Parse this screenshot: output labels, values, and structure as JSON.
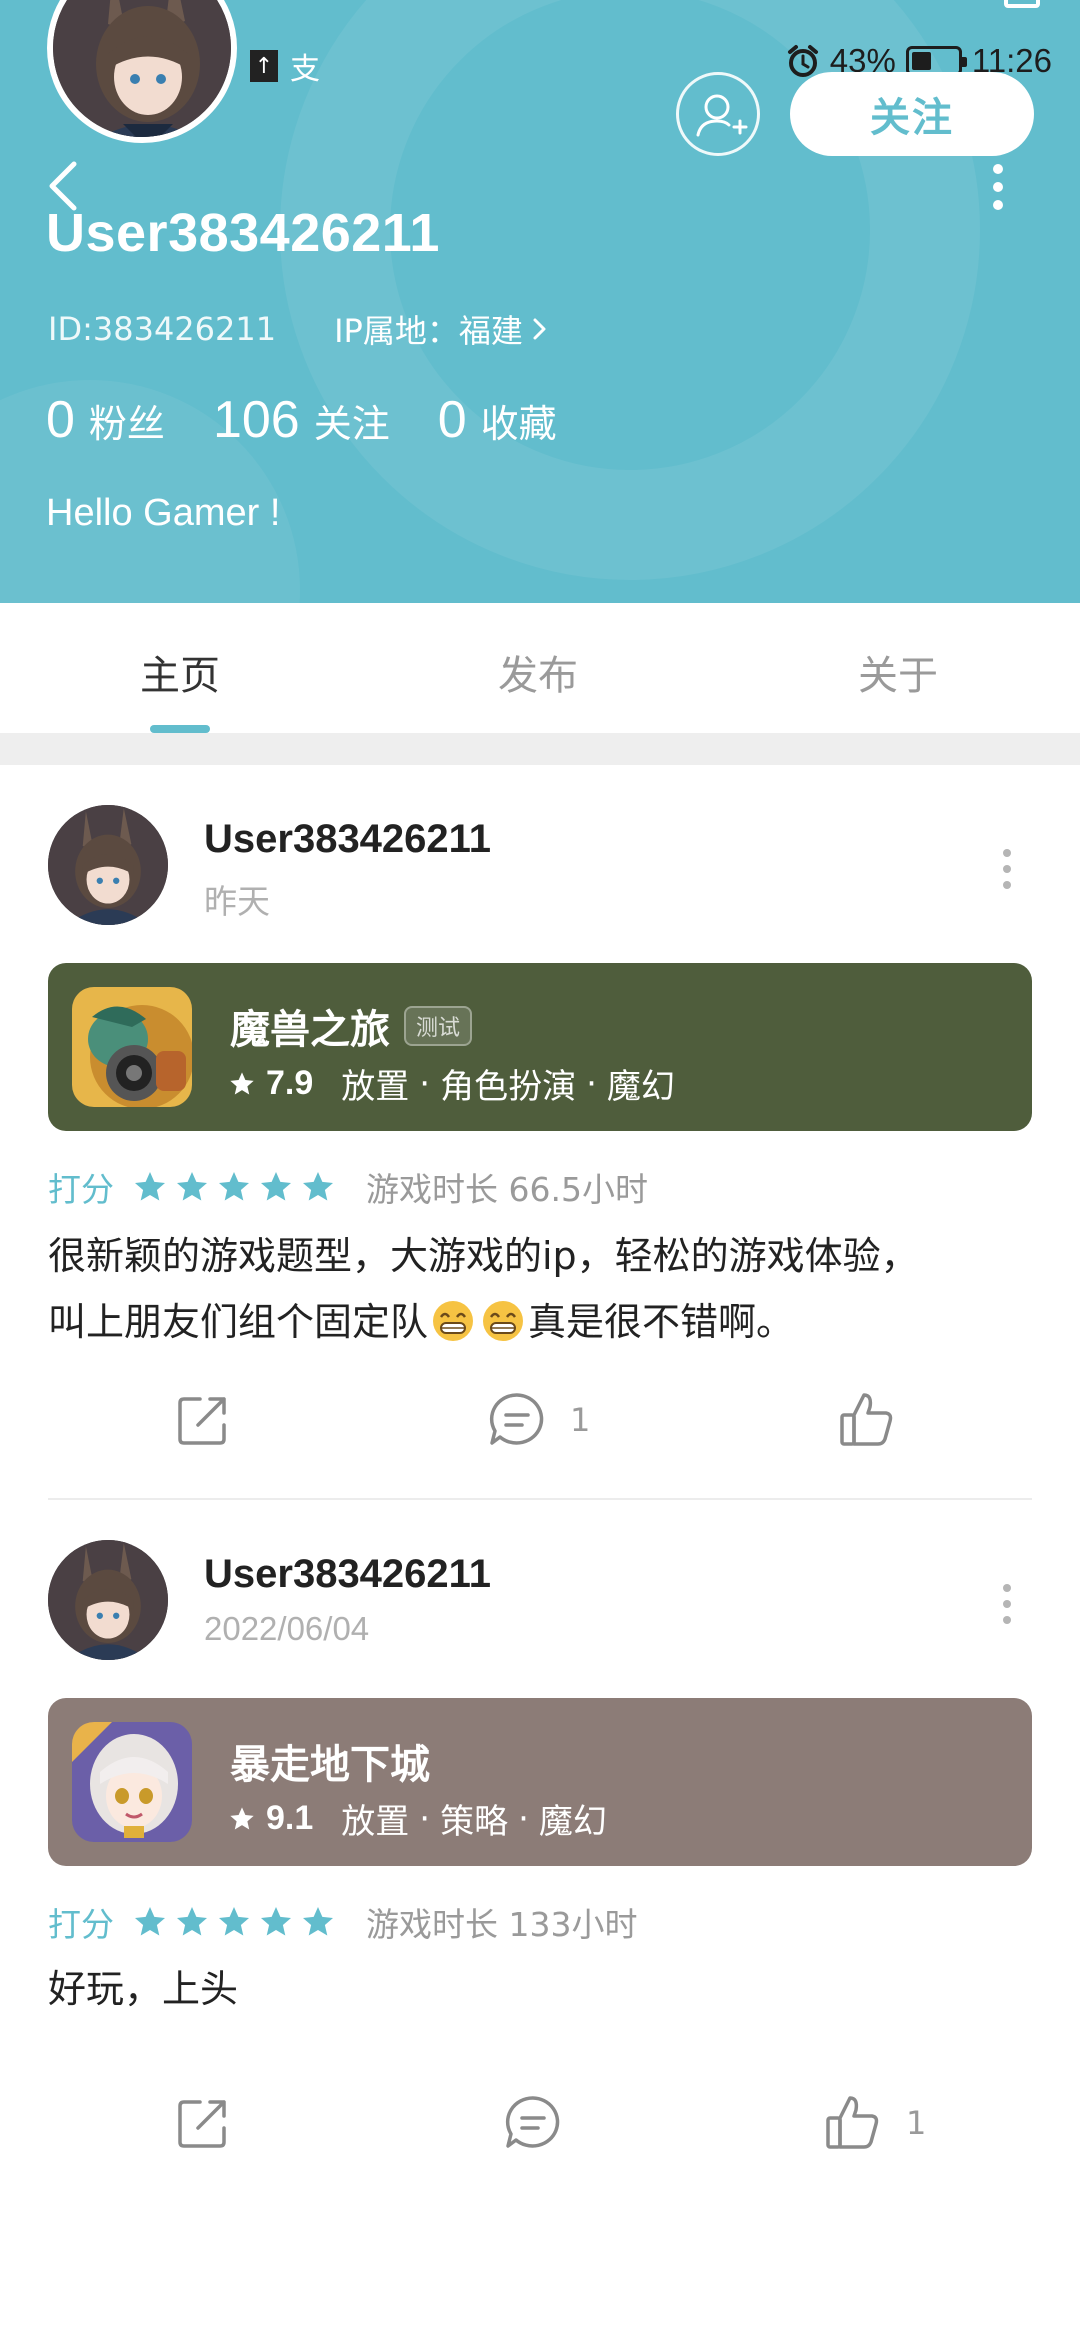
{
  "status_bar": {
    "alarm_icon": "alarm-icon",
    "battery_percent": "43%",
    "battery_level": 0.43,
    "time": "11:26"
  },
  "profile": {
    "username": "User383426211",
    "id_text": "ID:383426211",
    "ip_text": "IP属地：福建",
    "follow_label": "关注",
    "stats": [
      {
        "num": "0",
        "label": "粉丝"
      },
      {
        "num": "106",
        "label": "关注"
      },
      {
        "num": "0",
        "label": "收藏"
      }
    ],
    "bio": "Hello Gamer !"
  },
  "tabs": [
    {
      "label": "主页",
      "active": true
    },
    {
      "label": "发布",
      "active": false
    },
    {
      "label": "关于",
      "active": false
    }
  ],
  "posts": [
    {
      "username": "User383426211",
      "date": "昨天",
      "game": {
        "name": "魔兽之旅",
        "badge": "测试",
        "score": "7.9",
        "tags": [
          "放置",
          "角色扮演",
          "魔幻"
        ],
        "card_color": "#4f5d3c"
      },
      "rating_label": "打分",
      "stars": 5,
      "playtime": "游戏时长 66.5小时",
      "content_line1": "很新颖的游戏题型，大游戏的ip，轻松的游戏体验，",
      "content_line2_a": "叫上朋友们组个固定队",
      "content_line2_b": "真是很不错啊。",
      "comment_count": "1",
      "like_count": ""
    },
    {
      "username": "User383426211",
      "date": "2022/06/04",
      "game": {
        "name": "暴走地下城",
        "badge": "",
        "score": "9.1",
        "tags": [
          "放置",
          "策略",
          "魔幻"
        ],
        "card_color": "#8c7c77"
      },
      "rating_label": "打分",
      "stars": 5,
      "playtime": "游戏时长 133小时",
      "content_line1": "好玩，上头",
      "comment_count": "",
      "like_count": "1"
    }
  ],
  "colors": {
    "accent": "#62bdcd",
    "header_bg": "#62bdcd"
  }
}
